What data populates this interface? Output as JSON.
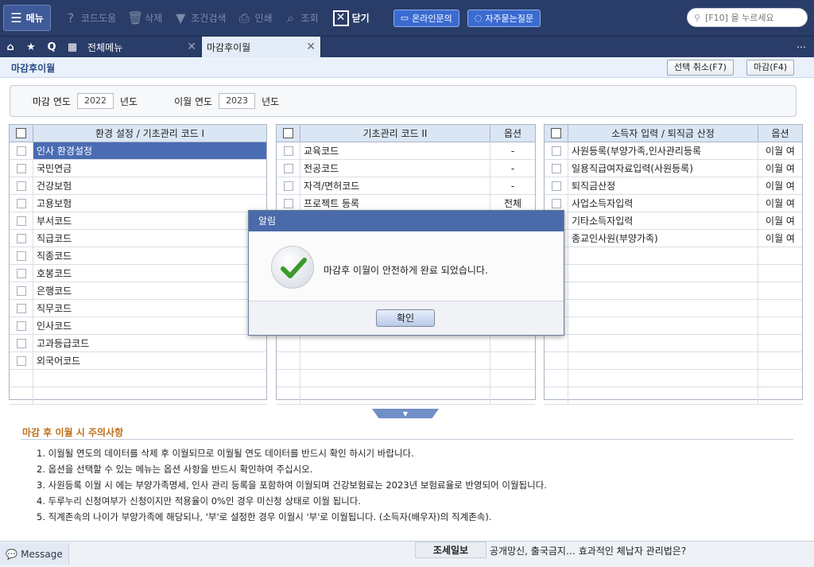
{
  "toolbar": {
    "menu": "메뉴",
    "items": [
      {
        "label": "코드도움",
        "icon": "question-icon"
      },
      {
        "label": "삭제",
        "icon": "trash-icon"
      },
      {
        "label": "조건검색",
        "icon": "filter-icon"
      },
      {
        "label": "인쇄",
        "icon": "printer-icon"
      },
      {
        "label": "조회",
        "icon": "search-doc-icon"
      }
    ],
    "close": "닫기",
    "online_inquiry": "온라인문의",
    "faq": "자주묻는질문",
    "search_placeholder": "[F10] 을 누르세요"
  },
  "tabs": {
    "all_menu": "전체메뉴",
    "active": "마감후이월"
  },
  "page": {
    "title": "마감후이월",
    "cancel_btn": "선택 취소(F7)",
    "close_btn": "마감(F4)",
    "close_year_label": "마감 연도",
    "close_year": "2022",
    "carry_year_label": "이월 연도",
    "carry_year": "2023",
    "year_unit": "년도"
  },
  "panel1": {
    "header": "환경 설정 / 기초관리 코드 I",
    "rows": [
      "인사 환경설정",
      "국민연금",
      "건강보험",
      "고용보험",
      "부서코드",
      "직급코드",
      "직종코드",
      "호봉코드",
      "은행코드",
      "직무코드",
      "인사코드",
      "고과등급코드",
      "외국어코드",
      "",
      ""
    ]
  },
  "panel2": {
    "header": "기초관리 코드 II",
    "option_header": "옵션",
    "rows": [
      {
        "name": "교육코드",
        "opt": "-"
      },
      {
        "name": "전공코드",
        "opt": "-"
      },
      {
        "name": "자격/면허코드",
        "opt": "-"
      },
      {
        "name": "프로젝트 등록",
        "opt": "전체"
      },
      {
        "name": "",
        "opt": ""
      },
      {
        "name": "",
        "opt": ""
      },
      {
        "name": "",
        "opt": ""
      },
      {
        "name": "",
        "opt": ""
      },
      {
        "name": "",
        "opt": ""
      },
      {
        "name": "",
        "opt": ""
      },
      {
        "name": "",
        "opt": ""
      },
      {
        "name": "",
        "opt": ""
      },
      {
        "name": "",
        "opt": ""
      },
      {
        "name": "",
        "opt": ""
      },
      {
        "name": "",
        "opt": ""
      }
    ]
  },
  "panel3": {
    "header": "소득자 입력 / 퇴직금 산정",
    "option_header": "옵션",
    "rows": [
      {
        "name": "사원등록(부양가족,인사관리등록",
        "opt": "이월 여"
      },
      {
        "name": "일용직급여자료입력(사원등록)",
        "opt": "이월 여"
      },
      {
        "name": "퇴직금산정",
        "opt": "이월 여"
      },
      {
        "name": "사업소득자입력",
        "opt": "이월 여"
      },
      {
        "name": "기타소득자입력",
        "opt": "이월 여"
      },
      {
        "name": "종교인사원(부양가족)",
        "opt": "이월 여"
      },
      {
        "name": "",
        "opt": ""
      },
      {
        "name": "",
        "opt": ""
      },
      {
        "name": "",
        "opt": ""
      },
      {
        "name": "",
        "opt": ""
      },
      {
        "name": "",
        "opt": ""
      },
      {
        "name": "",
        "opt": ""
      },
      {
        "name": "",
        "opt": ""
      },
      {
        "name": "",
        "opt": ""
      },
      {
        "name": "",
        "opt": ""
      }
    ]
  },
  "notice": {
    "title": "마감 후 이월 시 주의사항",
    "items": [
      "1. 이월될 연도의 데이터를 삭제 후 이월되므로 이월될 연도 데이터를 반드시 확인 하시기 바랍니다.",
      "2. 옵션을 선택할 수 있는 메뉴는 옵션 사항을 반드시 확인하여 주십시오.",
      "3. 사원등록 이월 시 에는 부양가족명세, 인사 관리 등록을 포함하여 이월되며 건강보험료는 2023년 보험료율로 반영되어 이월됩니다.",
      "4. 두루누리 신청여부가 신청이지만 적용율이 0%인 경우 미신청 상태로 이월 됩니다.",
      "5. 직계존속의 나이가 부양가족에 해당되나, '부'로 설정한 경우 이월시 '부'로 이월됩니다. (소득자(배우자)의 직계존속)."
    ]
  },
  "status": {
    "message_btn": "Message",
    "news_label": "조세일보",
    "news_text": "공개망신, 출국금지… 효과적인 체납자 관리법은?"
  },
  "modal": {
    "title": "알림",
    "message": "마감후 이월이 안전하게 완료 되었습니다.",
    "ok": "확인"
  }
}
